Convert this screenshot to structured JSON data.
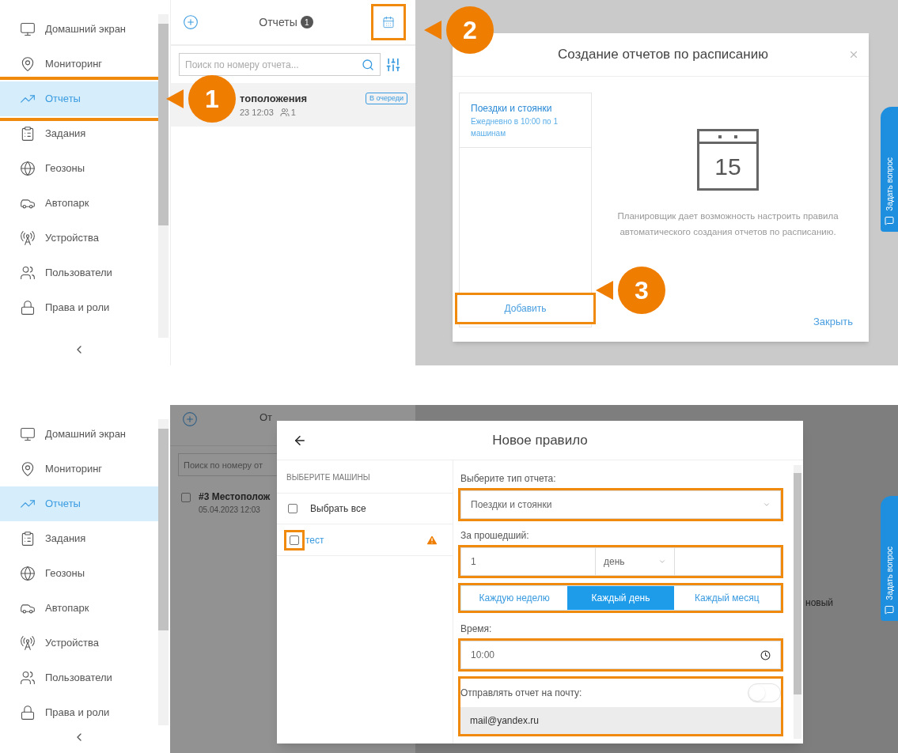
{
  "top_screen": {
    "sidebar": {
      "items": [
        {
          "kind": "monitor",
          "label": "Домашний экран",
          "selected": false,
          "annotated": false
        },
        {
          "kind": "pin",
          "label": "Мониторинг",
          "selected": false,
          "annotated": false
        },
        {
          "kind": "chart",
          "label": "Отчеты",
          "selected": true,
          "annotated": true
        },
        {
          "kind": "clipboard",
          "label": "Задания",
          "selected": false,
          "annotated": false
        },
        {
          "kind": "globe",
          "label": "Геозоны",
          "selected": false,
          "annotated": false
        },
        {
          "kind": "car",
          "label": "Автопарк",
          "selected": false,
          "annotated": false
        },
        {
          "kind": "antenna",
          "label": "Устройства",
          "selected": false,
          "annotated": false
        },
        {
          "kind": "users",
          "label": "Пользователи",
          "selected": false,
          "annotated": false
        },
        {
          "kind": "lock",
          "label": "Права и роли",
          "selected": false,
          "annotated": false
        }
      ]
    },
    "reports_panel": {
      "title": "Отчеты",
      "count": "1",
      "calendar_annotated": true,
      "search_placeholder": "Поиск по номеру отчета...",
      "report": {
        "title": "тоположения",
        "date": "23 12:03",
        "cars": "1",
        "status": "В очереди"
      }
    },
    "dialog": {
      "title": "Создание отчетов по расписанию",
      "rules": [
        {
          "name": "Поездки и стоянки",
          "schedule": "Ежедневно в 10:00 по 1 машинам"
        }
      ],
      "add_button": {
        "label": "Добавить",
        "annotated": true
      },
      "calendar_day": "15",
      "description": "Планировщик дает возможность настроить правила автоматического создания отчетов по расписанию.",
      "close_link": "Закрыть"
    },
    "help_tab": "Задать вопрос",
    "callouts": [
      {
        "number": "1"
      },
      {
        "number": "2"
      },
      {
        "number": "3"
      }
    ]
  },
  "bottom_screen": {
    "sidebar": {
      "items": [
        {
          "kind": "monitor",
          "label": "Домашний экран",
          "selected": false,
          "annotated": false
        },
        {
          "kind": "pin",
          "label": "Мониторинг",
          "selected": false,
          "annotated": false
        },
        {
          "kind": "chart",
          "label": "Отчеты",
          "selected": true,
          "annotated": false
        },
        {
          "kind": "clipboard",
          "label": "Задания",
          "selected": false,
          "annotated": false
        },
        {
          "kind": "globe",
          "label": "Геозоны",
          "selected": false,
          "annotated": false
        },
        {
          "kind": "car",
          "label": "Автопарк",
          "selected": false,
          "annotated": false
        },
        {
          "kind": "antenna",
          "label": "Устройства",
          "selected": false,
          "annotated": false
        },
        {
          "kind": "users",
          "label": "Пользователи",
          "selected": false,
          "annotated": false
        },
        {
          "kind": "lock",
          "label": "Права и роли",
          "selected": false,
          "annotated": false
        }
      ]
    },
    "reports_panel": {
      "title": "От",
      "search_placeholder": "Поиск по номеру от",
      "report": {
        "title": "#3 Местополож",
        "date": "05.04.2023 12:03",
        "checked": false
      }
    },
    "underlying_text": "новый",
    "help_tab": "Задать вопрос",
    "dialog": {
      "title": "Новое правило",
      "cars_heading": "ВЫБЕРИТЕ МАШИНЫ",
      "select_all": {
        "label": "Выбрать все",
        "checked": false
      },
      "cars": [
        {
          "name": "тест",
          "checked": false,
          "warning": true,
          "annotated": true
        }
      ],
      "report_type": {
        "label": "Выберите тип отчета:",
        "value": "Поездки и стоянки",
        "annotated": true
      },
      "period": {
        "label": "За прошедший:",
        "amount": "1",
        "unit": "день",
        "annotated": true
      },
      "frequency": {
        "annotated": true,
        "options": [
          {
            "label": "Каждую неделю",
            "selected": false
          },
          {
            "label": "Каждый день",
            "selected": true
          },
          {
            "label": "Каждый месяц",
            "selected": false
          }
        ]
      },
      "time": {
        "label": "Время:",
        "value": "10:00",
        "annotated": true
      },
      "email": {
        "label": "Отправлять отчет на почту:",
        "on": false,
        "value": "mail@yandex.ru",
        "annotated": true
      }
    }
  }
}
